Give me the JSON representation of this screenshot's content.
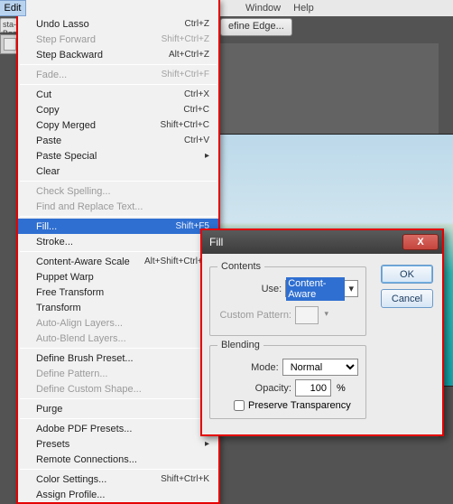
{
  "menubar": {
    "window": "Window",
    "help": "Help"
  },
  "side_tab": "sta-Beach",
  "refine_edge": "efine Edge...",
  "edit_menu": {
    "label": "Edit",
    "items": [
      {
        "label": "Undo Lasso",
        "shortcut": "Ctrl+Z",
        "enabled": true
      },
      {
        "label": "Step Forward",
        "shortcut": "Shift+Ctrl+Z",
        "enabled": false
      },
      {
        "label": "Step Backward",
        "shortcut": "Alt+Ctrl+Z",
        "enabled": true
      },
      {
        "sep": true
      },
      {
        "label": "Fade...",
        "shortcut": "Shift+Ctrl+F",
        "enabled": false
      },
      {
        "sep": true
      },
      {
        "label": "Cut",
        "shortcut": "Ctrl+X",
        "enabled": true
      },
      {
        "label": "Copy",
        "shortcut": "Ctrl+C",
        "enabled": true
      },
      {
        "label": "Copy Merged",
        "shortcut": "Shift+Ctrl+C",
        "enabled": true
      },
      {
        "label": "Paste",
        "shortcut": "Ctrl+V",
        "enabled": true
      },
      {
        "label": "Paste Special",
        "shortcut": "",
        "enabled": true,
        "submenu": true
      },
      {
        "label": "Clear",
        "shortcut": "",
        "enabled": true
      },
      {
        "sep": true
      },
      {
        "label": "Check Spelling...",
        "shortcut": "",
        "enabled": false
      },
      {
        "label": "Find and Replace Text...",
        "shortcut": "",
        "enabled": false
      },
      {
        "sep": true
      },
      {
        "label": "Fill...",
        "shortcut": "Shift+F5",
        "enabled": true,
        "selected": true
      },
      {
        "label": "Stroke...",
        "shortcut": "",
        "enabled": true
      },
      {
        "sep": true
      },
      {
        "label": "Content-Aware Scale",
        "shortcut": "Alt+Shift+Ctrl+C",
        "enabled": true
      },
      {
        "label": "Puppet Warp",
        "shortcut": "",
        "enabled": true
      },
      {
        "label": "Free Transform",
        "shortcut": "",
        "enabled": true
      },
      {
        "label": "Transform",
        "shortcut": "",
        "enabled": true,
        "submenu": true
      },
      {
        "label": "Auto-Align Layers...",
        "shortcut": "",
        "enabled": false
      },
      {
        "label": "Auto-Blend Layers...",
        "shortcut": "",
        "enabled": false
      },
      {
        "sep": true
      },
      {
        "label": "Define Brush Preset...",
        "shortcut": "",
        "enabled": true
      },
      {
        "label": "Define Pattern...",
        "shortcut": "",
        "enabled": false
      },
      {
        "label": "Define Custom Shape...",
        "shortcut": "",
        "enabled": false
      },
      {
        "sep": true
      },
      {
        "label": "Purge",
        "shortcut": "",
        "enabled": true,
        "submenu": true
      },
      {
        "sep": true
      },
      {
        "label": "Adobe PDF Presets...",
        "shortcut": "",
        "enabled": true
      },
      {
        "label": "Presets",
        "shortcut": "",
        "enabled": true,
        "submenu": true
      },
      {
        "label": "Remote Connections...",
        "shortcut": "",
        "enabled": true
      },
      {
        "sep": true
      },
      {
        "label": "Color Settings...",
        "shortcut": "Shift+Ctrl+K",
        "enabled": true
      },
      {
        "label": "Assign Profile...",
        "shortcut": "",
        "enabled": true
      }
    ]
  },
  "fill_dialog": {
    "title": "Fill",
    "contents_legend": "Contents",
    "use_label": "Use:",
    "use_value": "Content-Aware",
    "custom_pattern_label": "Custom Pattern:",
    "blending_legend": "Blending",
    "mode_label": "Mode:",
    "mode_value": "Normal",
    "opacity_label": "Opacity:",
    "opacity_value": "100",
    "opacity_unit": "%",
    "preserve_label": "Preserve Transparency",
    "ok": "OK",
    "cancel": "Cancel",
    "close_icon": "X"
  }
}
